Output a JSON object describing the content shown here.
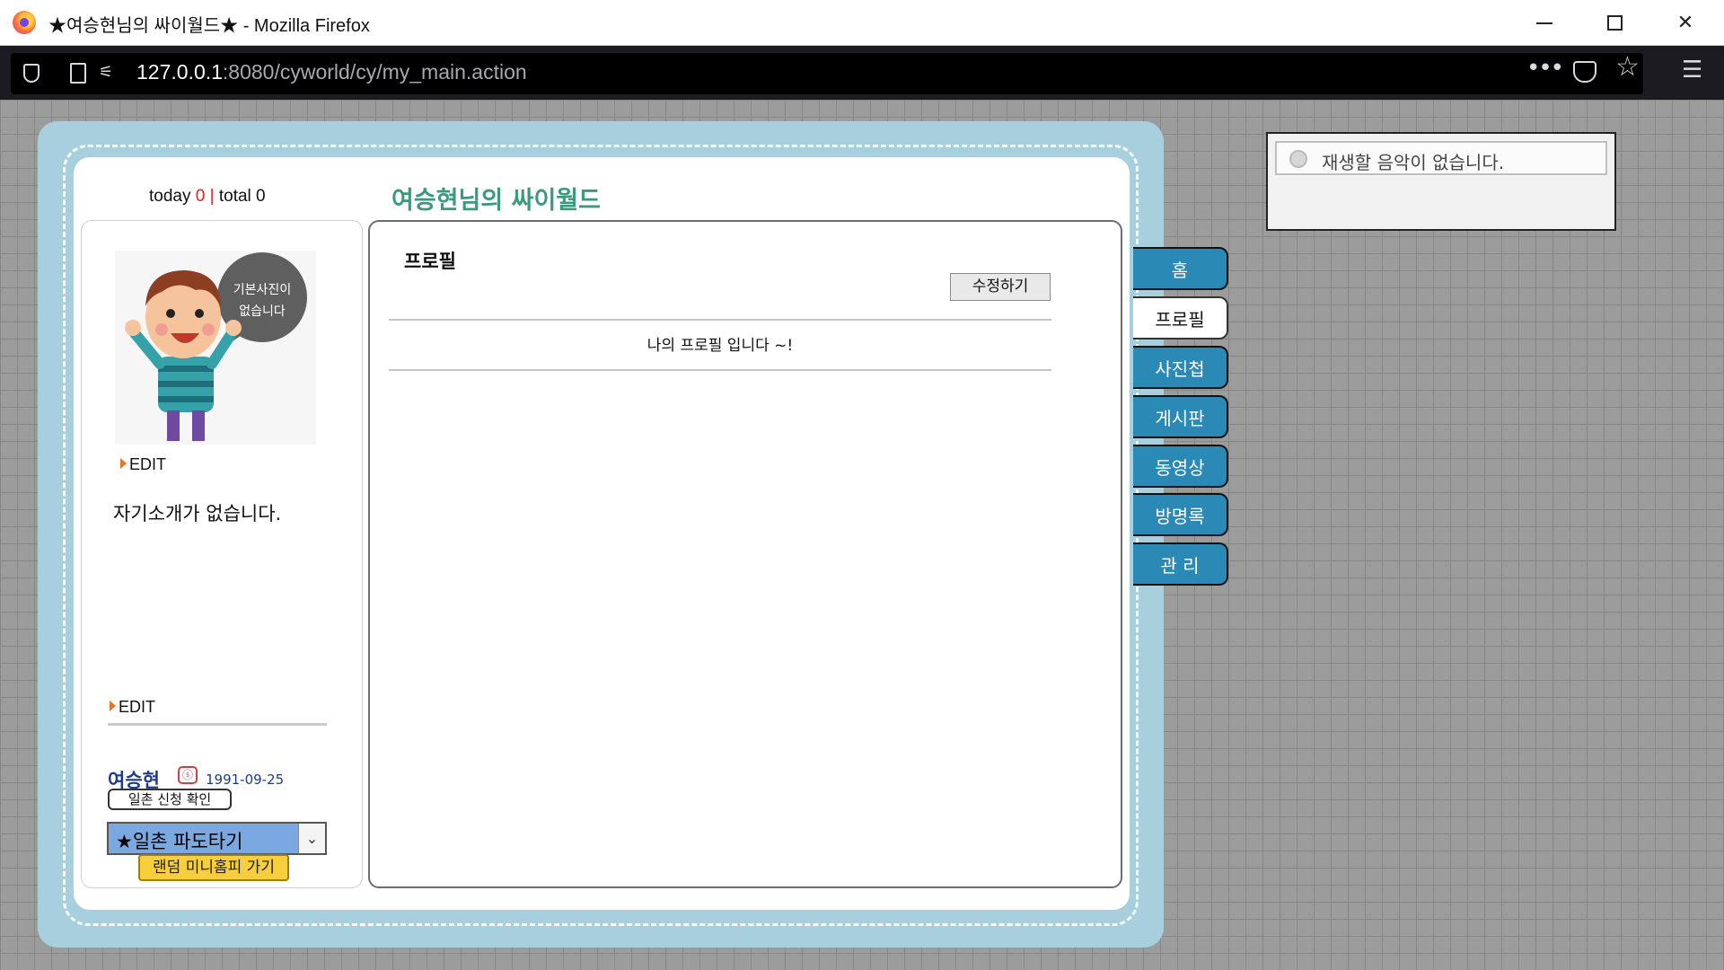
{
  "window": {
    "title": "★여승현님의 싸이월드★ - Mozilla Firefox"
  },
  "browser": {
    "url_host": "127.0.0.1",
    "url_rest": ":8080/cyworld/cy/my_main.action"
  },
  "header": {
    "today_label": "today",
    "today_count": "0",
    "separator": "|",
    "total_label": "total",
    "total_count": "0",
    "site_title": "여승현님의 싸이월드"
  },
  "left": {
    "edit_photo": "EDIT",
    "intro_text": "자기소개가 없습니다.",
    "edit_intro": "EDIT",
    "name": "여승현",
    "gender_mark": "ⓢ",
    "birthdate": "1991-09-25",
    "ilchon_button": "일촌 신청 확인",
    "wave_select": "★일촌 파도타기",
    "random_button": "랜덤 미니홈피 가기",
    "avatar_bubble_line1": "기본사진이",
    "avatar_bubble_line2": "없습니다"
  },
  "main": {
    "heading": "프로필",
    "edit_button": "수정하기",
    "profile_text": "나의 프로필 입니다 ~!"
  },
  "tabs": [
    {
      "label": "홈",
      "active": false
    },
    {
      "label": "프로필",
      "active": true
    },
    {
      "label": "사진첩",
      "active": false
    },
    {
      "label": "게시판",
      "active": false
    },
    {
      "label": "동영상",
      "active": false
    },
    {
      "label": "방명록",
      "active": false
    },
    {
      "label": "관 리",
      "active": false
    }
  ],
  "music": {
    "status": "재생할 음악이 없습니다."
  },
  "colors": {
    "frame": "#a8cfdd",
    "tab_bg": "#2a8ab5",
    "title_green": "#3b9a7c",
    "name_blue": "#1d3b87",
    "random_yellow": "#f7cf3d"
  }
}
